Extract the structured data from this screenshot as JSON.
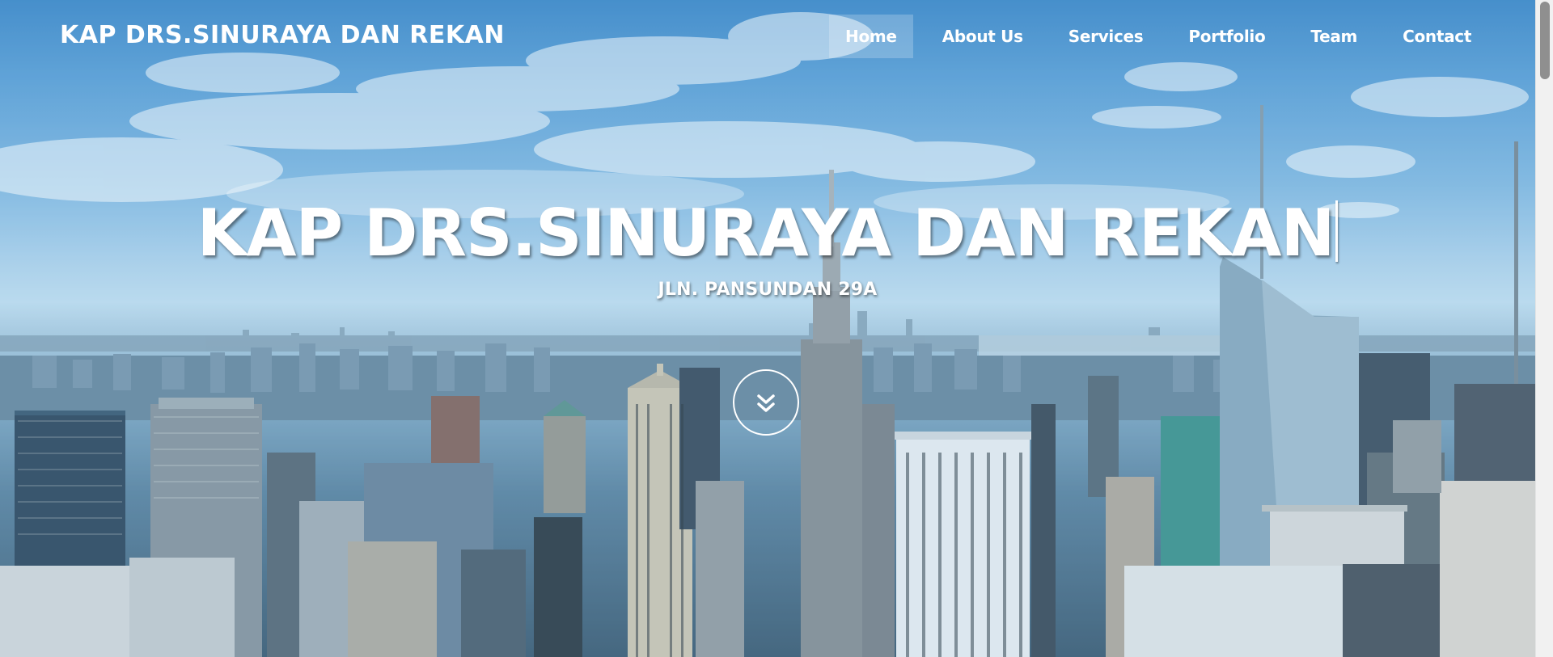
{
  "nav": {
    "brand": "KAP DRS.SINURAYA DAN REKAN",
    "items": [
      {
        "label": "Home",
        "active": true
      },
      {
        "label": "About Us",
        "active": false
      },
      {
        "label": "Services",
        "active": false
      },
      {
        "label": "Portfolio",
        "active": false
      },
      {
        "label": "Team",
        "active": false
      },
      {
        "label": "Contact",
        "active": false
      }
    ]
  },
  "hero": {
    "title": "KAP DRS.SINURAYA DAN REKAN",
    "subtitle": "JLN. PANSUNDAN 29A",
    "scroll_icon": "double-chevron-down-icon",
    "background": "city-skyline-photo"
  },
  "colors": {
    "text": "#ffffff",
    "sky_top": "#2f7fc4",
    "sky_horizon": "#bcdbee",
    "city_dark": "#2e4f68"
  }
}
